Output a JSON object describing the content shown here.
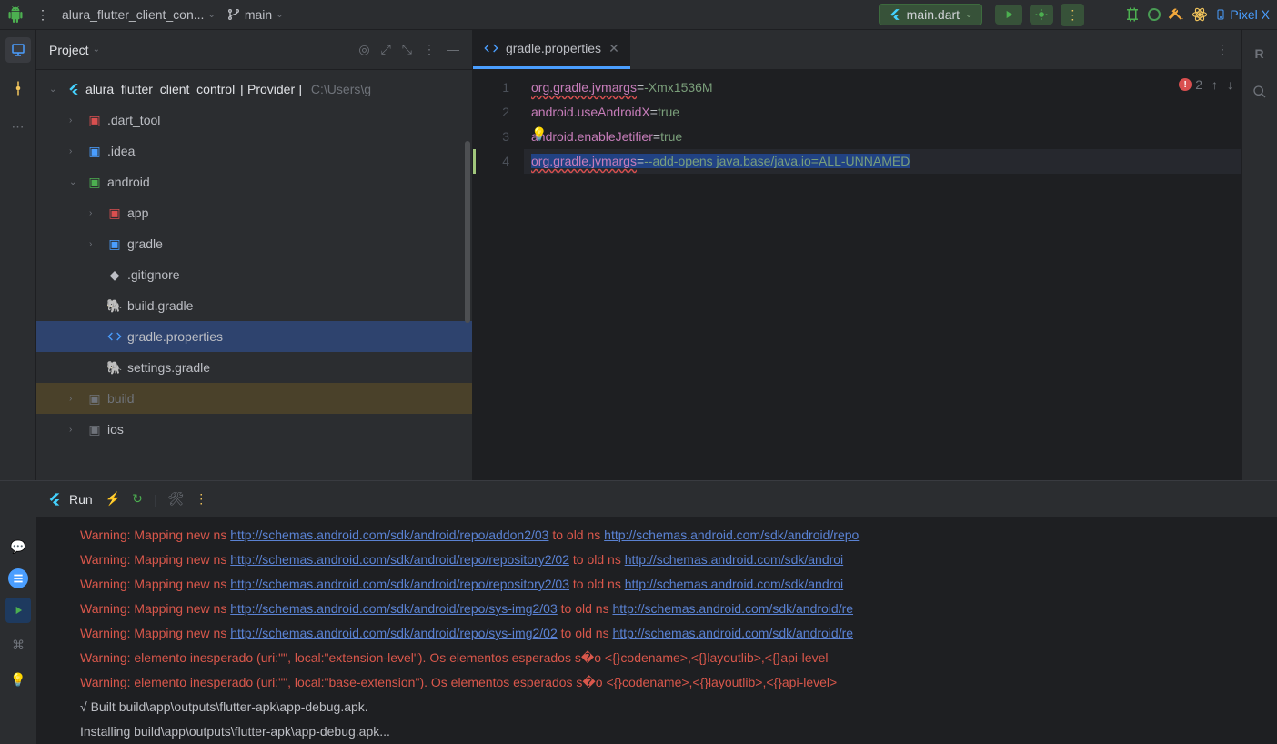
{
  "toolbar": {
    "project_name": "alura_flutter_client_con...",
    "branch": "main",
    "run_config": "main.dart",
    "device": "Pixel X"
  },
  "project_panel": {
    "title": "Project",
    "root_name": "alura_flutter_client_control",
    "root_qualifier": "[ Provider ]",
    "root_path": "C:\\Users\\g",
    "items": {
      "dart_tool": ".dart_tool",
      "idea": ".idea",
      "android": "android",
      "app": "app",
      "gradle": "gradle",
      "gitignore": ".gitignore",
      "build_gradle": "build.gradle",
      "gradle_properties": "gradle.properties",
      "settings_gradle": "settings.gradle",
      "build": "build",
      "ios": "ios"
    }
  },
  "editor": {
    "tab_name": "gradle.properties",
    "error_count": "2",
    "lines": [
      {
        "num": "1",
        "key": "org.gradle.jvmargs",
        "val": "-Xmx1536M"
      },
      {
        "num": "2",
        "key": "android.useAndroidX",
        "val": "true"
      },
      {
        "num": "3",
        "key": "android.enableJetifier",
        "val": "true"
      },
      {
        "num": "4",
        "key": "org.gradle.jvmargs",
        "val": "--add-opens java.base/java.io=ALL-UNNAMED"
      }
    ]
  },
  "run": {
    "title": "Run",
    "warning_prefix": "Warning: Mapping new ns ",
    "to_old": " to old ns ",
    "urls": {
      "u1": "http://schemas.android.com/sdk/android/repo/addon2/03",
      "u1b": "http://schemas.android.com/sdk/android/repo",
      "u2": "http://schemas.android.com/sdk/android/repo/repository2/02",
      "u2b": "http://schemas.android.com/sdk/androi",
      "u3": "http://schemas.android.com/sdk/android/repo/repository2/03",
      "u4": "http://schemas.android.com/sdk/android/repo/sys-img2/03",
      "u4b": "http://schemas.android.com/sdk/android/re",
      "u5": "http://schemas.android.com/sdk/android/repo/sys-img2/02"
    },
    "w6": "Warning: elemento inesperado (uri:\"\", local:\"extension-level\"). Os elementos esperados s�o <{}codename>,<{}layoutlib>,<{}api-level",
    "w7": "Warning: elemento inesperado (uri:\"\", local:\"base-extension\"). Os elementos esperados s�o <{}codename>,<{}layoutlib>,<{}api-level>",
    "built": "√  Built build\\app\\outputs\\flutter-apk\\app-debug.apk.",
    "installing": "Installing build\\app\\outputs\\flutter-apk\\app-debug.apk..."
  }
}
